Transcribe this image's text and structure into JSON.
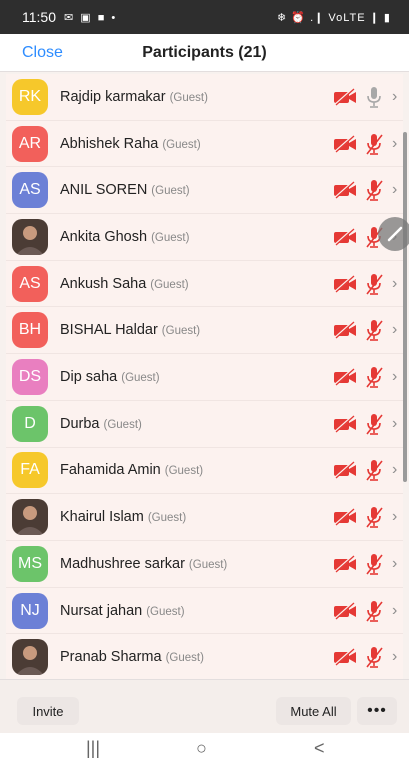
{
  "status_bar": {
    "time": "11:50",
    "left_icons": "✉ ▣ ■ •",
    "right_icons": "❄ ⏰ .❙ VoLTE ❙ ▮"
  },
  "header": {
    "close_label": "Close",
    "title": "Participants (21)"
  },
  "participants": [
    {
      "name": "Rajdip karmakar",
      "role": "(Guest)",
      "initials": "RK",
      "color": "#f6c82b",
      "photo": false,
      "mic_muted": false
    },
    {
      "name": "Abhishek Raha",
      "role": "(Guest)",
      "initials": "AR",
      "color": "#f2605b",
      "photo": false,
      "mic_muted": true
    },
    {
      "name": "ANIL SOREN",
      "role": "(Guest)",
      "initials": "AS",
      "color": "#6c80d6",
      "photo": false,
      "mic_muted": true
    },
    {
      "name": "Ankita Ghosh",
      "role": "(Guest)",
      "initials": "",
      "color": "#4b3c35",
      "photo": true,
      "mic_muted": true
    },
    {
      "name": "Ankush Saha",
      "role": "(Guest)",
      "initials": "AS",
      "color": "#f2605b",
      "photo": false,
      "mic_muted": true
    },
    {
      "name": "BISHAL Haldar",
      "role": "(Guest)",
      "initials": "BH",
      "color": "#f2605b",
      "photo": false,
      "mic_muted": true
    },
    {
      "name": "Dip saha",
      "role": "(Guest)",
      "initials": "DS",
      "color": "#e97fc0",
      "photo": false,
      "mic_muted": true
    },
    {
      "name": "Durba",
      "role": "(Guest)",
      "initials": "D",
      "color": "#6cc46a",
      "photo": false,
      "mic_muted": true
    },
    {
      "name": "Fahamida Amin",
      "role": "(Guest)",
      "initials": "FA",
      "color": "#f6c82b",
      "photo": false,
      "mic_muted": true
    },
    {
      "name": "Khairul Islam",
      "role": "(Guest)",
      "initials": "",
      "color": "#4b3c35",
      "photo": true,
      "mic_muted": true
    },
    {
      "name": "Madhushree sarkar",
      "role": "(Guest)",
      "initials": "MS",
      "color": "#6cc46a",
      "photo": false,
      "mic_muted": true
    },
    {
      "name": "Nursat jahan",
      "role": "(Guest)",
      "initials": "NJ",
      "color": "#6c80d6",
      "photo": false,
      "mic_muted": true
    },
    {
      "name": "Pranab Sharma",
      "role": "(Guest)",
      "initials": "",
      "color": "#4b3c35",
      "photo": true,
      "mic_muted": true
    }
  ],
  "footer": {
    "invite_label": "Invite",
    "mute_all_label": "Mute All",
    "more_label": "•••"
  },
  "nav": {
    "recents": "|||",
    "home": "○",
    "back": "<"
  },
  "colors": {
    "accent": "#2d8cff",
    "muted_red": "#e53935",
    "mic_gray": "#a8a8a8"
  }
}
